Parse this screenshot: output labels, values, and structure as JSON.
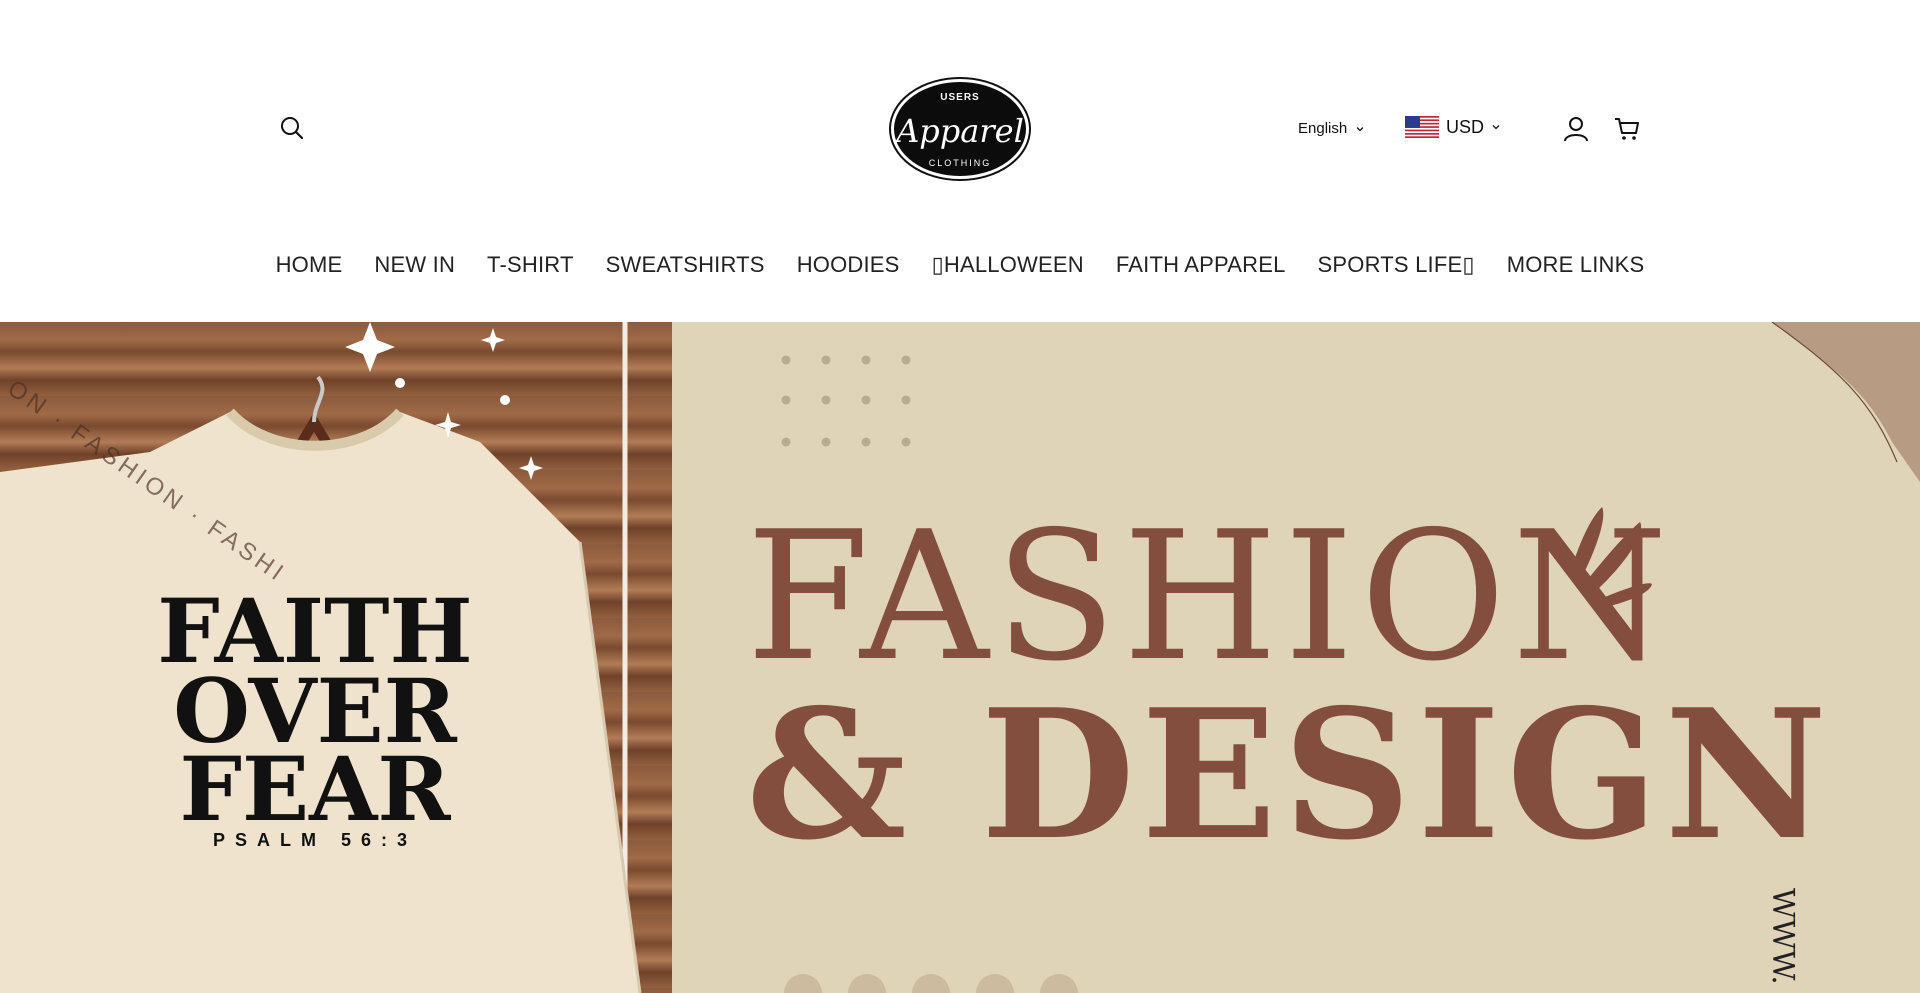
{
  "header": {
    "search_icon": "search-icon",
    "logo": {
      "line1": "USERS",
      "line2": "Apparel",
      "line3": "CLOTHING"
    },
    "language": {
      "selected": "English"
    },
    "currency": {
      "selected": "USD",
      "flag": "us-flag"
    },
    "account_icon": "user-icon",
    "cart_icon": "cart-icon"
  },
  "nav": {
    "items": [
      {
        "label": "HOME"
      },
      {
        "label": "NEW IN"
      },
      {
        "label": "T-SHIRT"
      },
      {
        "label": "SWEATSHIRTS"
      },
      {
        "label": "HOODIES"
      },
      {
        "label": "▯HALLOWEEN"
      },
      {
        "label": "FAITH APPAREL"
      },
      {
        "label": "SPORTS LIFE▯"
      },
      {
        "label": "MORE LINKS"
      }
    ]
  },
  "hero": {
    "shirt_text": {
      "line1": "FAITH",
      "line2": "OVER",
      "line3": "FEAR",
      "line4": "PSALM 56:3"
    },
    "curved_text": "ON · FASHION · FASHI",
    "headline_1": "FASHION",
    "headline_2": "& DESIGN",
    "vertical_text": "WWW.",
    "colors": {
      "panel": "#dfd3b8",
      "headline": "#844e3e"
    }
  }
}
